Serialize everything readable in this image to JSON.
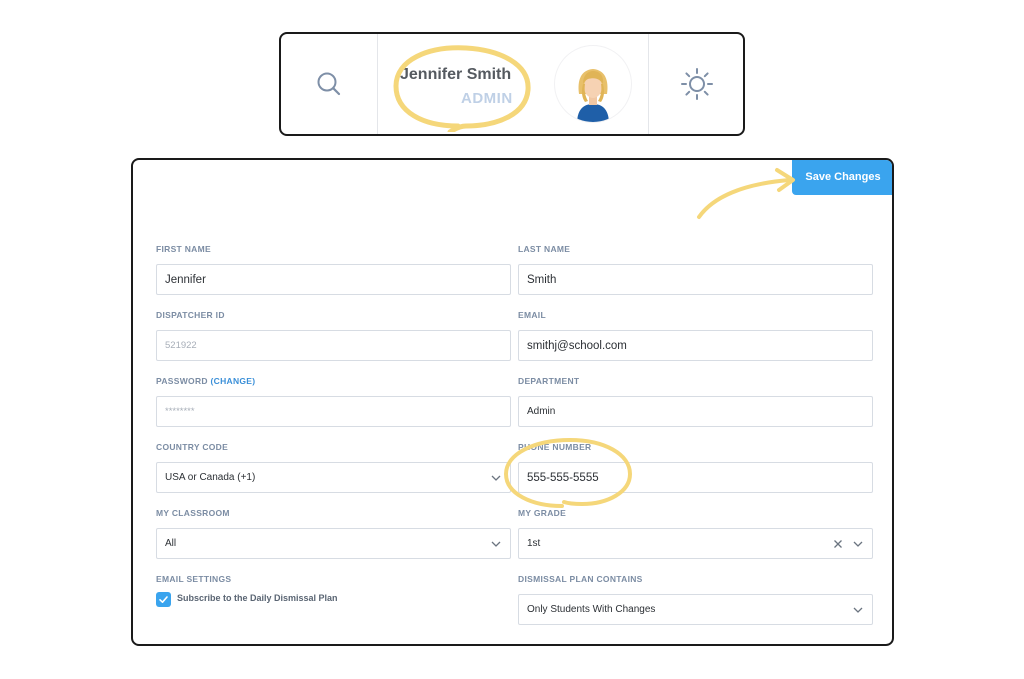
{
  "header": {
    "user_name": "Jennifer Smith",
    "user_role": "ADMIN",
    "icons": {
      "search": "search-icon",
      "settings": "sun-settings-icon",
      "avatar": "avatar"
    }
  },
  "toolbar": {
    "save_label": "Save Changes"
  },
  "form": {
    "first_name": {
      "label": "FIRST NAME",
      "value": "Jennifer"
    },
    "last_name": {
      "label": "LAST NAME",
      "value": "Smith"
    },
    "dispatcher_id": {
      "label": "DISPATCHER ID",
      "value": "521922"
    },
    "email": {
      "label": "EMAIL",
      "value": "smithj@school.com"
    },
    "password": {
      "label": "PASSWORD",
      "change_link": "(CHANGE)",
      "value": "********"
    },
    "department": {
      "label": "DEPARTMENT",
      "value": "Admin"
    },
    "country_code": {
      "label": "COUNTRY CODE",
      "value": "USA or Canada (+1)"
    },
    "phone_number": {
      "label": "PHONE NUMBER",
      "value": "555-555-5555"
    },
    "my_classroom": {
      "label": "MY CLASSROOM",
      "value": "All"
    },
    "my_grade": {
      "label": "MY GRADE",
      "value": "1st"
    },
    "email_settings": {
      "label": "EMAIL SETTINGS",
      "checkbox_label": "Subscribe to the Daily Dismissal Plan",
      "checked": true
    },
    "dismissal_plan": {
      "label": "DISMISSAL PLAN CONTAINS",
      "value": "Only Students With Changes"
    }
  },
  "colors": {
    "accent": "#3aa4ee",
    "highlight": "#f5d77a",
    "label": "#7b8ca3"
  }
}
